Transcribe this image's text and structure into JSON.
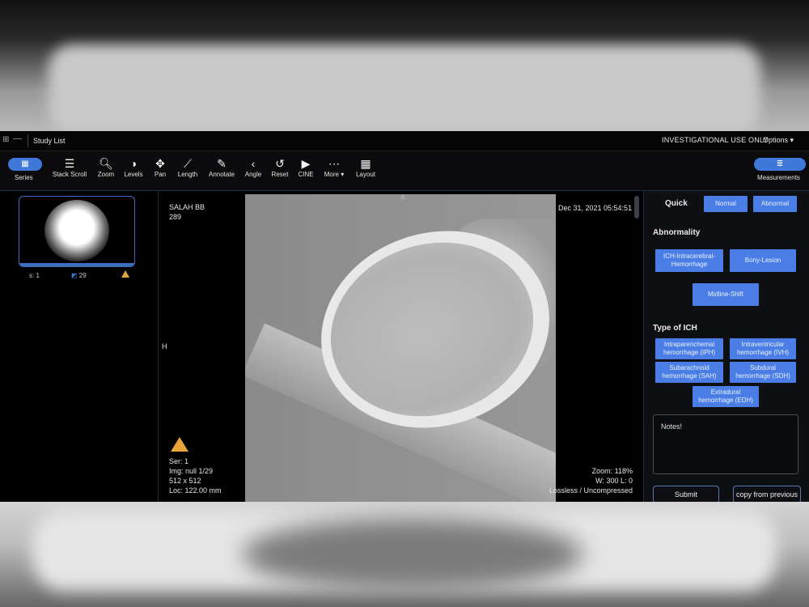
{
  "topbar": {
    "study_list": "Study List",
    "investigational": "INVESTIGATIONAL USE ONLY",
    "options": "Options"
  },
  "toolbar": {
    "series_label": "Series",
    "measurements_label": "Measurements",
    "tools": [
      {
        "label": "Stack Scroll",
        "icon": "stack-scroll-icon"
      },
      {
        "label": "Zoom",
        "icon": "zoom-icon"
      },
      {
        "label": "Levels",
        "icon": "levels-icon"
      },
      {
        "label": "Pan",
        "icon": "pan-icon"
      },
      {
        "label": "Length",
        "icon": "length-icon"
      },
      {
        "label": "Annotate",
        "icon": "annotate-icon"
      },
      {
        "label": "Angle",
        "icon": "angle-icon"
      },
      {
        "label": "Reset",
        "icon": "reset-icon"
      },
      {
        "label": "CINE",
        "icon": "cine-icon"
      },
      {
        "label": "More",
        "icon": "more-icon"
      },
      {
        "label": "Layout",
        "icon": "layout-icon"
      }
    ]
  },
  "thumbnail": {
    "series_no": "s: 1",
    "image_count": "29"
  },
  "viewport": {
    "orientation_top": "A",
    "orientation_left": "H",
    "patient_name": "SALAH BB",
    "patient_id": "289",
    "datetime": "Dec 31, 2021 05:54:51",
    "series": "Ser: 1",
    "image": "Img: null 1/29",
    "matrix": "512 x 512",
    "location": "Loc: 122.00 mm",
    "zoom": "Zoom: 118%",
    "window": "W: 300 L: 0",
    "compression": "Lossless / Uncompressed"
  },
  "form": {
    "quick_label": "Quick",
    "normal": "Normal",
    "abnormal": "Abnormal",
    "abnormality_label": "Abnormality",
    "ich": "ICH-Intracerebral-Hemorrhage",
    "bony_lesion": "Bony-Lesion",
    "midline_shift": "Midline-Shift",
    "type_label": "Type of ICH",
    "iph": "Intraparenchemal hemorrhage (IPH)",
    "ivh": "Intraventricular hemorrhage (IVH)",
    "sah": "Subarachnoid hemorrhage (SAH)",
    "sdh": "Subdural hemorrhage (SDH)",
    "edh": "Extradural hemorrhage (EDH)",
    "notes_value": "Notes!",
    "submit": "Submit",
    "copy_previous": "copy from previous"
  },
  "colors": {
    "accent": "#4a7ee6",
    "warning": "#e9a53a"
  }
}
